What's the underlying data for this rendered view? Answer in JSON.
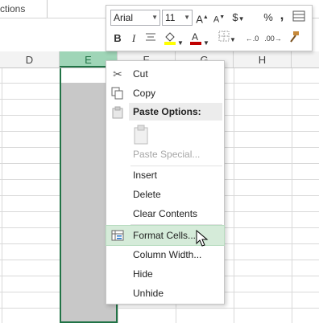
{
  "ribbon": {
    "partial_label": "ctions"
  },
  "columns": [
    "D",
    "E",
    "F",
    "G",
    "H"
  ],
  "selected_column": "E",
  "mini_toolbar": {
    "font_name": "Arial",
    "font_size": "11",
    "increase_font": "A",
    "decrease_font": "A",
    "currency": "$",
    "percent": "%",
    "comma": ",",
    "bold": "B",
    "italic": "I",
    "fill_color": "#ffff00",
    "font_color": "#c00000"
  },
  "context_menu": {
    "cut": "Cut",
    "copy": "Copy",
    "paste_options": "Paste Options:",
    "paste_special": "Paste Special...",
    "insert": "Insert",
    "delete": "Delete",
    "clear_contents": "Clear Contents",
    "format_cells": "Format Cells...",
    "column_width": "Column Width...",
    "hide": "Hide",
    "unhide": "Unhide"
  },
  "colors": {
    "accent": "#217346",
    "highlight": "#d5ebd9",
    "selection_fill": "#c8c8c8"
  }
}
